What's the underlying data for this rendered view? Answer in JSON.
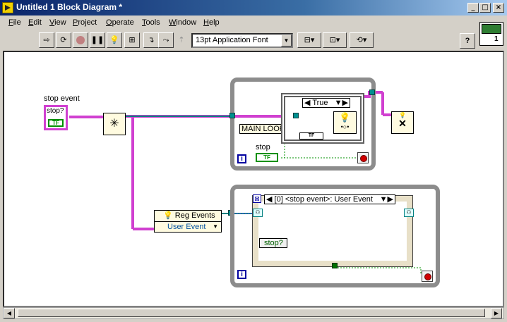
{
  "window": {
    "title": "Untitled 1 Block Diagram *",
    "controls": [
      "_",
      "□",
      "×"
    ]
  },
  "menu": [
    {
      "label": "File",
      "acc": "F",
      "rest": "ile"
    },
    {
      "label": "Edit",
      "acc": "E",
      "rest": "dit"
    },
    {
      "label": "View",
      "acc": "V",
      "rest": "iew"
    },
    {
      "label": "Project",
      "acc": "P",
      "rest": "roject"
    },
    {
      "label": "Operate",
      "acc": "O",
      "rest": "perate"
    },
    {
      "label": "Tools",
      "acc": "T",
      "rest": "ools"
    },
    {
      "label": "Window",
      "acc": "W",
      "rest": "indow"
    },
    {
      "label": "Help",
      "acc": "H",
      "rest": "elp"
    }
  ],
  "toolbar": {
    "buttons": [
      "run-arrow",
      "run-continuous",
      "abort",
      "pause",
      "highlight-execution",
      "retain-wire-values",
      "step-into",
      "step-over",
      "step-out"
    ],
    "font": "13pt Application Font",
    "help": "?"
  },
  "diagram": {
    "stop_event_label": "stop event",
    "stop_event_indicator": "stop?",
    "stop_event_terminal": "TF",
    "main_loop_label": "MAIN LOOP",
    "case_selector": "True",
    "stop_label": "stop",
    "stop_terminal": "TF",
    "tf_const": "TF",
    "reg_events_label": "Reg Events",
    "user_event_label": "User Event",
    "event_case_label": "[0] <stop event>: User Event",
    "event_data_stop": "stop?",
    "loop_iter": "i"
  },
  "colors": {
    "boolean_wire": "#009000",
    "event_wire": "#d040d0",
    "refnum_wire": "#008080",
    "loop_border": "#8c8c8c",
    "node_fill": "#fffbe0"
  }
}
